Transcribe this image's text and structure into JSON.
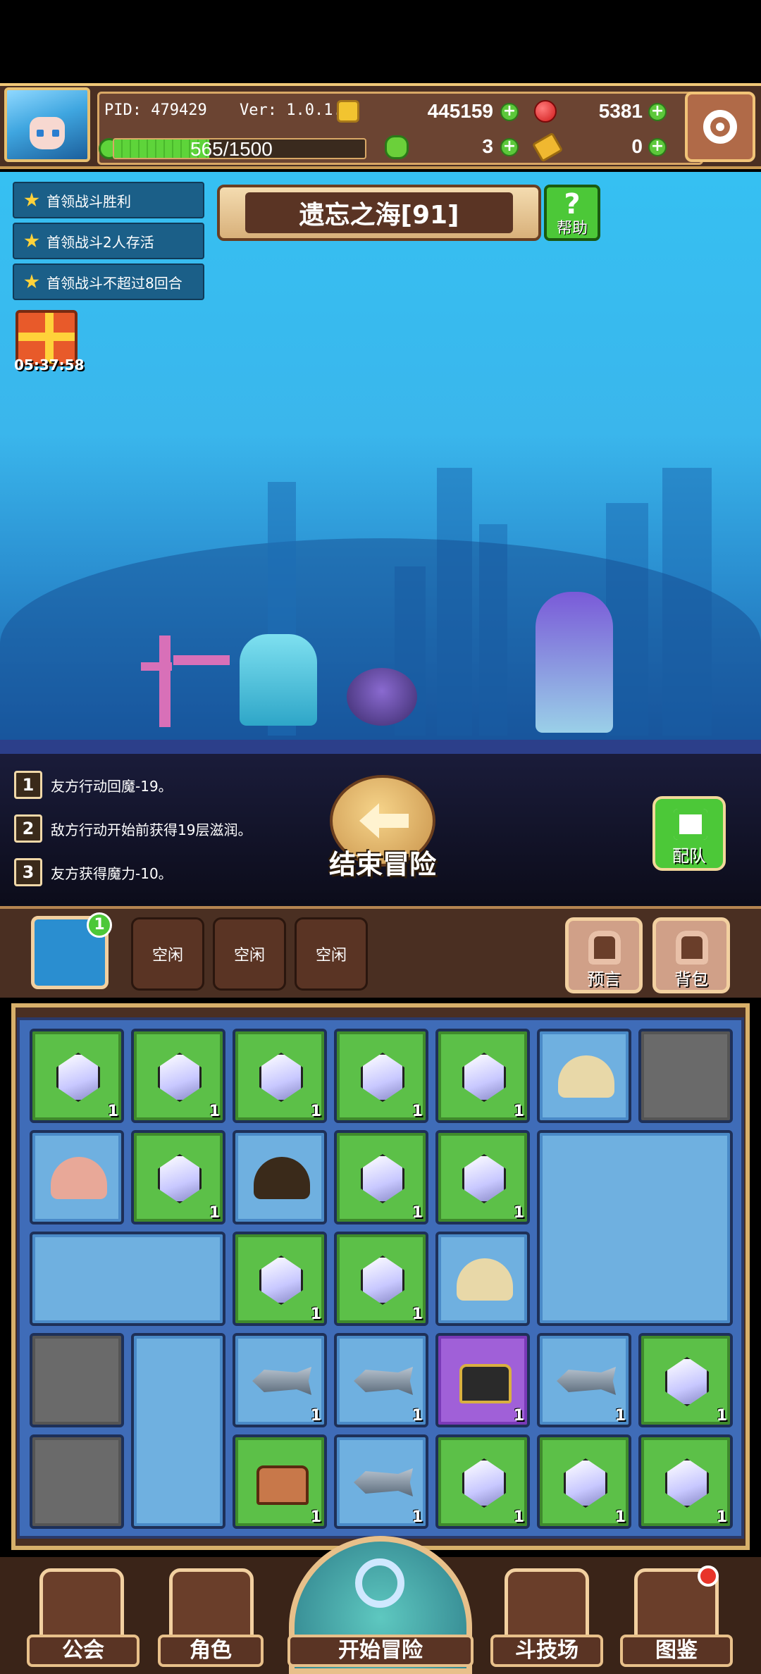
{
  "header": {
    "pid": "PID: 479429",
    "version": "Ver: 1.0.1.2",
    "gold": "445159",
    "gems": "5381",
    "hp": "565/1500",
    "hp_fraction": 0.38,
    "clovers": "3",
    "keys": "0"
  },
  "quests": [
    {
      "label": "首领战斗胜利"
    },
    {
      "label": "首领战斗2人存活"
    },
    {
      "label": "首领战斗不超过8回合"
    }
  ],
  "gift": {
    "timer": "05:37:58"
  },
  "stage": {
    "title": "遗忘之海[91]",
    "help_label": "帮助"
  },
  "battle_log": [
    {
      "num": "1",
      "text": "友方行动回魔-19。"
    },
    {
      "num": "2",
      "text": "敌方行动开始前获得19层滋润。"
    },
    {
      "num": "3",
      "text": "友方获得魔力-10。"
    }
  ],
  "end_button": "结束冒险",
  "team_button": "配队",
  "slots": {
    "map_badge": "1",
    "idle": [
      "空闲",
      "空闲",
      "空闲"
    ],
    "prophecy_label": "预言",
    "bag_label": "背包"
  },
  "inventory": {
    "rows": [
      [
        {
          "t": "gem",
          "c": "1"
        },
        {
          "t": "gem",
          "c": "1"
        },
        {
          "t": "gem",
          "c": "1"
        },
        {
          "t": "gem",
          "c": "1"
        },
        {
          "t": "gem",
          "c": "1"
        },
        {
          "t": "clam",
          "c": ""
        },
        {
          "t": "grey",
          "c": ""
        }
      ],
      [
        {
          "t": "shell",
          "c": ""
        },
        {
          "t": "gem",
          "c": "1"
        },
        {
          "t": "pot",
          "c": ""
        },
        {
          "t": "gem",
          "c": "1"
        },
        {
          "t": "gem",
          "c": "1"
        }
      ],
      [
        {
          "t": "gem",
          "c": "1"
        },
        {
          "t": "gem",
          "c": "1"
        },
        {
          "t": "clam",
          "c": ""
        }
      ],
      [
        {
          "t": "grey",
          "c": ""
        },
        {
          "t": "fish",
          "c": "1"
        },
        {
          "t": "fish",
          "c": "1"
        },
        {
          "t": "chestb",
          "c": "1"
        },
        {
          "t": "fish",
          "c": "1"
        },
        {
          "t": "gem",
          "c": "1"
        }
      ],
      [
        {
          "t": "grey",
          "c": ""
        },
        {
          "t": "chest",
          "c": "1"
        },
        {
          "t": "fish",
          "c": "1"
        },
        {
          "t": "gem",
          "c": "1"
        },
        {
          "t": "gem",
          "c": "1"
        },
        {
          "t": "gem",
          "c": "1"
        }
      ]
    ]
  },
  "nav": [
    {
      "label": "公会"
    },
    {
      "label": "角色"
    },
    {
      "label": "开始冒险"
    },
    {
      "label": "斗技场"
    },
    {
      "label": "图鉴"
    }
  ],
  "colors": {
    "accent_green": "#5cc048",
    "frame_gold": "#d8b06a",
    "panel_brown": "#4a2f22"
  }
}
